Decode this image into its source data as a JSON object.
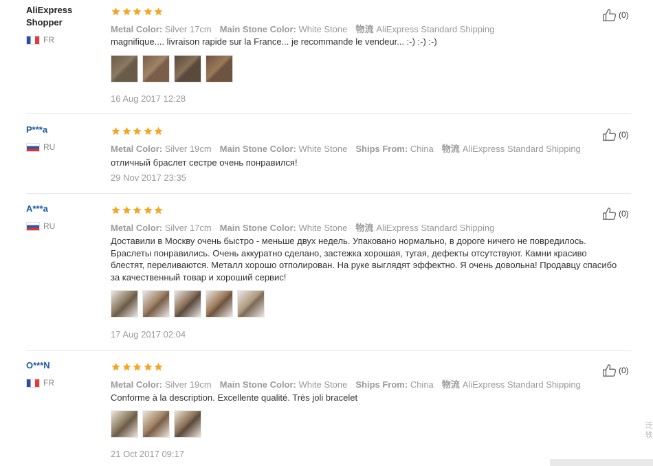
{
  "reviews": [
    {
      "user": "AliExpress Shopper",
      "user_style": "shopper",
      "country": "FR",
      "flag": "fr",
      "rating": 5,
      "attributes": [
        {
          "label": "Metal Color:",
          "value": "Silver 17cm"
        },
        {
          "label": "Main Stone Color:",
          "value": "White Stone"
        }
      ],
      "shipping_icon": "物流",
      "shipping": "AliExpress Standard Shipping",
      "text": "magnifique.... livraison rapide sur la France... je recommande le vendeur... :-) :-) :-)",
      "photos": [
        "bracelet-wrist-photo",
        "bracelet-wrist-photo",
        "bracelet-wrist-photo",
        "bracelet-wrist-photo"
      ],
      "date": "16 Aug 2017 12:28",
      "helpful": "(0)"
    },
    {
      "user": "P***a",
      "user_style": "masked",
      "country": "RU",
      "flag": "ru",
      "rating": 5,
      "attributes": [
        {
          "label": "Metal Color:",
          "value": "Silver 19cm"
        },
        {
          "label": "Main Stone Color:",
          "value": "White Stone"
        },
        {
          "label": "Ships From:",
          "value": "China"
        }
      ],
      "shipping_icon": "物流",
      "shipping": "AliExpress Standard Shipping",
      "text": "отличный браслет сестре очень понравился!",
      "photos": [],
      "date": "29 Nov 2017 23:35",
      "helpful": "(0)"
    },
    {
      "user": "A***a",
      "user_style": "masked",
      "country": "RU",
      "flag": "ru",
      "rating": 5,
      "attributes": [
        {
          "label": "Metal Color:",
          "value": "Silver 17cm"
        },
        {
          "label": "Main Stone Color:",
          "value": "White Stone"
        }
      ],
      "shipping_icon": "物流",
      "shipping": "AliExpress Standard Shipping",
      "text": "Доставили в Москву очень быстро - меньше двух недель. Упаковано нормально, в дороге ничего не повредилось. Браслеты понравились. Очень аккуратно сделано, застежка хорошая, тугая, дефекты отсутствуют. Камни красиво блестят, переливаются. Металл хорошо отполирован. На руке выглядят эффектно. Я очень довольна! Продавцу спасибо за качественный товар и хороший сервис!",
      "photos": [
        "bracelet-photo",
        "bracelet-photo",
        "bracelet-photo",
        "bracelet-photo",
        "bracelet-photo"
      ],
      "date": "17 Aug 2017 02:04",
      "helpful": "(0)"
    },
    {
      "user": "O***N",
      "user_style": "masked",
      "country": "FR",
      "flag": "fr",
      "rating": 5,
      "attributes": [
        {
          "label": "Metal Color:",
          "value": "Silver 19cm"
        },
        {
          "label": "Main Stone Color:",
          "value": "White Stone"
        },
        {
          "label": "Ships From:",
          "value": "China"
        }
      ],
      "shipping_icon": "物流",
      "shipping": "AliExpress Standard Shipping",
      "text": "Conforme à la description. Excellente qualité. Très joli bracelet",
      "photos": [
        "bracelet-photo",
        "bracelet-photo",
        "pouch-photo"
      ],
      "date": "21 Oct 2017 09:17",
      "helpful": "(0)"
    }
  ],
  "side_glyph": "泛 轶",
  "colors": {
    "star": "#f5a623",
    "masked_user": "#1a5aa8",
    "muted": "#999999"
  }
}
